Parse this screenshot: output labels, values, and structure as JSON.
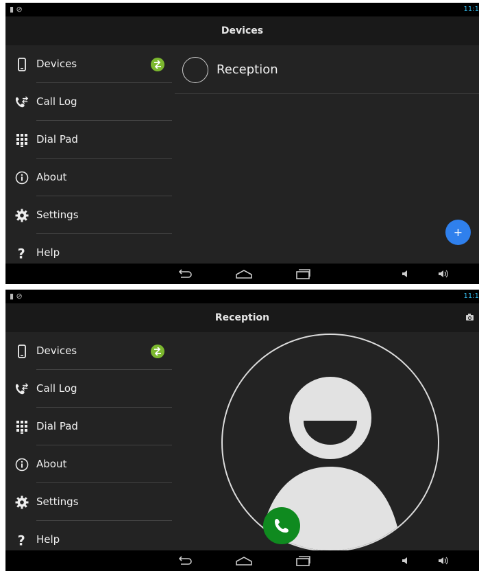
{
  "screen1": {
    "status_time": "11:1",
    "title": "Devices",
    "drawer": {
      "items": [
        {
          "label": "Devices",
          "icon": "phone-device-icon"
        },
        {
          "label": "Call Log",
          "icon": "call-log-icon"
        },
        {
          "label": "Dial Pad",
          "icon": "dial-pad-icon"
        },
        {
          "label": "About",
          "icon": "info-icon"
        },
        {
          "label": "Settings",
          "icon": "gear-icon"
        },
        {
          "label": "Help",
          "icon": "question-icon"
        }
      ]
    },
    "devices": [
      {
        "name": "Reception"
      }
    ],
    "fab_label": "+"
  },
  "screen2": {
    "status_time": "11:1",
    "title": "Reception",
    "drawer": {
      "items": [
        {
          "label": "Devices",
          "icon": "phone-device-icon"
        },
        {
          "label": "Call Log",
          "icon": "call-log-icon"
        },
        {
          "label": "Dial Pad",
          "icon": "dial-pad-icon"
        },
        {
          "label": "About",
          "icon": "info-icon"
        },
        {
          "label": "Settings",
          "icon": "gear-icon"
        },
        {
          "label": "Help",
          "icon": "question-icon"
        }
      ]
    }
  },
  "colors": {
    "background": "#232323",
    "bar": "#000000",
    "status_time": "#33b5e5",
    "badge": "#7cb82f",
    "fab": "#2f80ed",
    "call": "#0f8a1f"
  }
}
